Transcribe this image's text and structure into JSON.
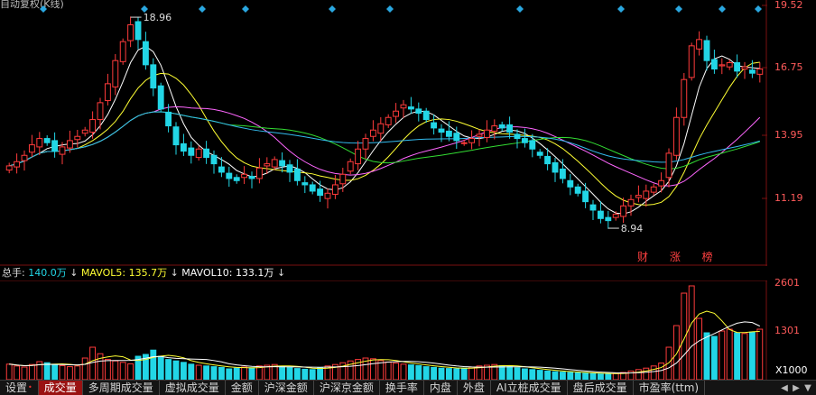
{
  "header": {
    "title": "自动复权(K线)"
  },
  "price_axis": {
    "ticks": [
      "19.52",
      "16.75",
      "13.95",
      "11.19"
    ]
  },
  "price_annotations": {
    "high": "18.96",
    "low": "8.94"
  },
  "event_label": "财 涨 榜",
  "volume_legend": {
    "total_label": "总手:",
    "total_value": "140.0万",
    "ma5_label": "MAVOL5:",
    "ma5_value": "135.7万",
    "ma10_label": "MAVOL10:",
    "ma10_value": "133.1万",
    "arrow": "↓"
  },
  "volume_axis": {
    "ticks": [
      "2601",
      "1301"
    ],
    "multiplier": "X1000"
  },
  "tabs": [
    {
      "label": "设置",
      "active": false,
      "dot": "•"
    },
    {
      "label": "成交量",
      "active": true
    },
    {
      "label": "多周期成交量",
      "active": false
    },
    {
      "label": "虚拟成交量",
      "active": false
    },
    {
      "label": "金额",
      "active": false
    },
    {
      "label": "沪深金额",
      "active": false
    },
    {
      "label": "沪深京金额",
      "active": false
    },
    {
      "label": "换手率",
      "active": false
    },
    {
      "label": "内盘",
      "active": false
    },
    {
      "label": "外盘",
      "active": false
    },
    {
      "label": "AI立桩成交量",
      "active": false
    },
    {
      "label": "盘后成交量",
      "active": false
    },
    {
      "label": "市盈率(ttm)",
      "active": false
    }
  ],
  "tab_nav": {
    "prev": "◀",
    "next": "▶",
    "menu": "▼"
  },
  "colors": {
    "up": "#ff3b3b",
    "down": "#22d6e6",
    "ma5": "#ffffff",
    "ma10": "#ffff33",
    "ma20": "#ff66ff",
    "ma30": "#33dd33",
    "ma60": "#33bbee",
    "grid": "#7a1010"
  },
  "chart_data": {
    "type": "candlestick",
    "price_ylim": [
      8.0,
      19.52
    ],
    "volume_ylim_thousands": [
      0,
      2601
    ],
    "series_note": "daily K-line, ~100 sessions",
    "close": [
      11.9,
      12.1,
      12.4,
      12.9,
      13.2,
      13.0,
      12.6,
      12.8,
      13.1,
      13.3,
      13.6,
      14.1,
      14.9,
      15.8,
      16.9,
      17.8,
      18.6,
      17.9,
      16.7,
      15.6,
      14.6,
      13.8,
      12.9,
      12.6,
      12.4,
      12.7,
      12.3,
      12.0,
      11.6,
      11.3,
      11.2,
      11.5,
      11.3,
      11.8,
      12.0,
      12.2,
      11.9,
      11.6,
      11.2,
      11.0,
      10.7,
      10.5,
      10.6,
      11.0,
      11.5,
      12.1,
      12.7,
      13.2,
      13.6,
      13.9,
      14.2,
      14.5,
      14.8,
      14.6,
      14.4,
      14.1,
      13.7,
      13.5,
      13.3,
      13.1,
      13.0,
      13.2,
      13.4,
      13.6,
      13.8,
      13.7,
      13.5,
      13.2,
      13.0,
      12.7,
      12.4,
      12.0,
      11.6,
      11.3,
      10.9,
      10.6,
      10.2,
      9.8,
      9.4,
      9.3,
      9.6,
      10.0,
      10.3,
      10.5,
      10.7,
      10.9,
      11.2,
      12.5,
      14.2,
      16.0,
      17.6,
      17.9,
      16.9,
      16.5,
      16.7,
      16.8,
      16.4,
      16.6,
      16.3,
      16.5
    ],
    "volume": [
      430,
      380,
      350,
      420,
      500,
      470,
      410,
      390,
      360,
      380,
      600,
      900,
      720,
      560,
      520,
      480,
      440,
      650,
      700,
      820,
      650,
      560,
      520,
      480,
      430,
      400,
      380,
      360,
      340,
      300,
      320,
      350,
      330,
      380,
      400,
      420,
      370,
      340,
      310,
      290,
      280,
      330,
      380,
      420,
      470,
      520,
      560,
      600,
      580,
      530,
      490,
      460,
      430,
      410,
      390,
      360,
      340,
      320,
      310,
      300,
      320,
      350,
      380,
      400,
      420,
      390,
      360,
      330,
      300,
      280,
      260,
      240,
      220,
      210,
      200,
      190,
      180,
      170,
      160,
      160,
      170,
      200,
      240,
      280,
      320,
      380,
      460,
      900,
      1500,
      2400,
      2601,
      1700,
      1300,
      1200,
      1350,
      1400,
      1300,
      1280,
      1320,
      1400
    ],
    "ma5_volume_thousands": 1357,
    "ma10_volume_thousands": 1331
  }
}
